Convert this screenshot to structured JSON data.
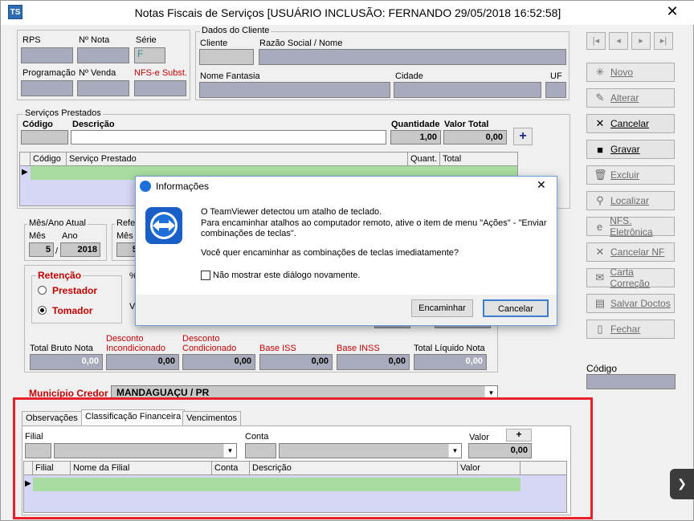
{
  "window": {
    "title": "Notas Fiscais de Serviços  [USUÁRIO INCLUSÃO: FERNANDO 29/05/2018 16:52:58]",
    "app_icon": "TS",
    "close": "✕"
  },
  "header_fields": {
    "rps": "RPS",
    "nota": "Nº Nota",
    "serie": "Série",
    "serie_value": "F",
    "programacao": "Programação",
    "venda": "Nº Venda",
    "nfse_subst": "NFS-e Subst."
  },
  "cliente": {
    "group": "Dados do Cliente",
    "cliente": "Cliente",
    "razao": "Razão Social / Nome",
    "fantasia": "Nome Fantasia",
    "cidade": "Cidade",
    "uf": "UF"
  },
  "servicos": {
    "group": "Serviços Prestados",
    "codigo": "Código",
    "descricao": "Descrição",
    "quantidade": "Quantidade",
    "valor_total": "Valor Total",
    "qtd_value": "1,00",
    "valor_value": "0,00",
    "add": "+",
    "columns": [
      "Código",
      "Serviço Prestado",
      "Quant.",
      "Total"
    ]
  },
  "periodo": {
    "group": "Mês/Ano Atual",
    "mes": "Mês",
    "ano": "Ano",
    "mes_value": "5",
    "sep": "/",
    "ano_value": "2018",
    "ref_group": "Refer",
    "ref_mes": "Mês",
    "ref_mes_value": "5"
  },
  "retencao": {
    "group": "Retenção",
    "prestador": "Prestador",
    "tomador": "Tomador",
    "partial1": "%",
    "partial2": "V"
  },
  "totais": [
    {
      "label": "Total Bruto Nota",
      "value": "0,00",
      "red": false
    },
    {
      "label": "Desconto\nIncondicionado",
      "value": "0,00",
      "red": true
    },
    {
      "label": "Desconto\nCondicionado",
      "value": "0,00",
      "red": true
    },
    {
      "label": "Base ISS",
      "value": "0,00",
      "red": true
    },
    {
      "label": "Base INSS",
      "value": "0,00",
      "red": true
    },
    {
      "label": "Total Líquido Nota",
      "value": "0,00",
      "red": false
    }
  ],
  "municipio": {
    "label": "Município Credor",
    "value": "MANDAGUAÇU / PR"
  },
  "tabs": [
    "Observações",
    "Classificação Financeira",
    "Vencimentos"
  ],
  "classificacao": {
    "filial": "Filial",
    "conta": "Conta",
    "valor": "Valor",
    "add": "+",
    "valor_value": "0,00",
    "columns": [
      "Filial",
      "Nome da Filial",
      "Conta",
      "Descrição",
      "Valor"
    ]
  },
  "toolbar": {
    "nav": [
      "|◂",
      "◂",
      "▸",
      "▸|"
    ],
    "buttons": [
      {
        "label": "Novo",
        "icon": "new-icon",
        "glyph": "✳",
        "active": false
      },
      {
        "label": "Alterar",
        "icon": "edit-icon",
        "glyph": "✎",
        "active": false
      },
      {
        "label": "Cancelar",
        "icon": "cancel-x-icon",
        "glyph": "✕",
        "active": true
      },
      {
        "label": "Gravar",
        "icon": "save-icon",
        "glyph": "■",
        "active": true
      },
      {
        "label": "Excluir",
        "icon": "trash-icon",
        "glyph": "🗑",
        "active": false
      },
      {
        "label": "Localizar",
        "icon": "search-icon",
        "glyph": "⚲",
        "active": false
      },
      {
        "label": "NFS. Eletrônica",
        "icon": "nfse-icon",
        "glyph": "e",
        "active": false
      },
      {
        "label": "Cancelar NF",
        "icon": "cancel-nf-icon",
        "glyph": "✕",
        "active": false
      },
      {
        "label": "Carta Correção",
        "icon": "letter-icon",
        "glyph": "✉",
        "active": false
      },
      {
        "label": "Salvar Doctos",
        "icon": "scan-icon",
        "glyph": "▤",
        "active": false
      },
      {
        "label": "Fechar",
        "icon": "close-doc-icon",
        "glyph": "▯",
        "active": false
      }
    ],
    "codigo": "Código"
  },
  "dialog": {
    "title": "Informações",
    "close": "✕",
    "line1": "O TeamViewer detectou um atalho de teclado.",
    "line2": "Para encaminhar atalhos ao computador remoto, ative o item de menu \"Ações\" - \"Enviar",
    "line3": "combinações de teclas\".",
    "line4": "Você quer encaminhar as combinações de teclas imediatamente?",
    "checkbox": "Não mostrar este diálogo novamente.",
    "btn_forward": "Encaminhar",
    "btn_cancel": "Cancelar"
  },
  "side_tab": "❯"
}
